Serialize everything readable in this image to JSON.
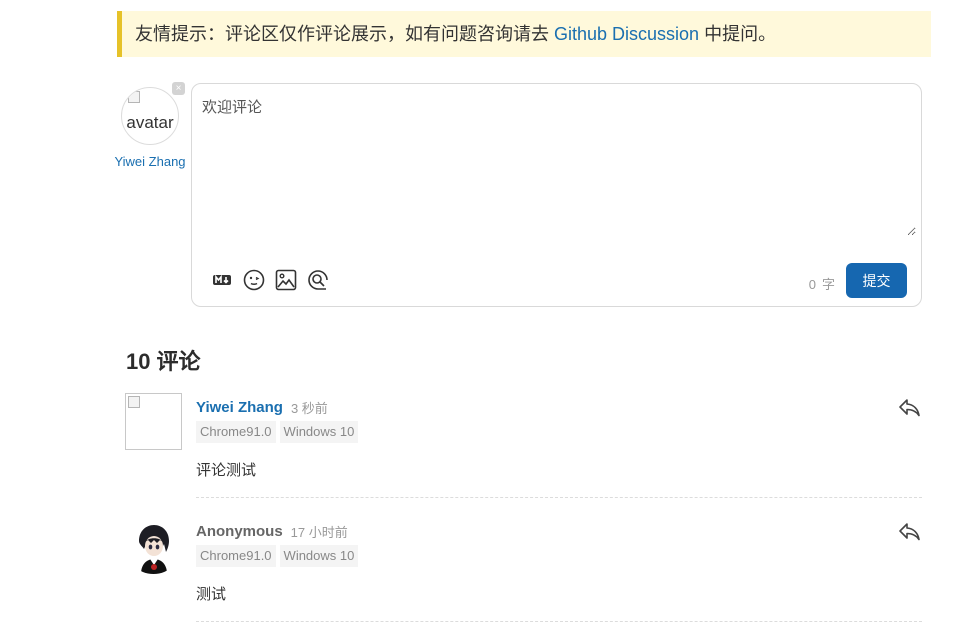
{
  "notice": {
    "prefix": "友情提示：评论区仅作评论展示，如有问题咨询请去 ",
    "link": "Github Discussion",
    "suffix": " 中提问。"
  },
  "author": {
    "avatar_alt": "avatar",
    "close_glyph": "×",
    "name": "Yiwei Zhang"
  },
  "editor": {
    "placeholder": "欢迎评论",
    "value": "",
    "toolbar": [
      "markdown-icon",
      "emoji-icon",
      "image-icon",
      "preview-icon"
    ],
    "word_count": "0",
    "word_unit": "字",
    "submit_label": "提交"
  },
  "comments_header": {
    "count": "10",
    "label": "评论"
  },
  "comments": [
    {
      "name": "Yiwei Zhang",
      "time": "3 秒前",
      "browser": "Chrome91.0",
      "os": "Windows 10",
      "text": "评论测试"
    },
    {
      "name": "Anonymous",
      "time": "17 小时前",
      "browser": "Chrome91.0",
      "os": "Windows 10",
      "text": "测试"
    }
  ],
  "colors": {
    "accent": "#1667b0",
    "link": "#1a6fb0",
    "notice_bg": "#fff9db",
    "notice_border": "#e6c229"
  }
}
